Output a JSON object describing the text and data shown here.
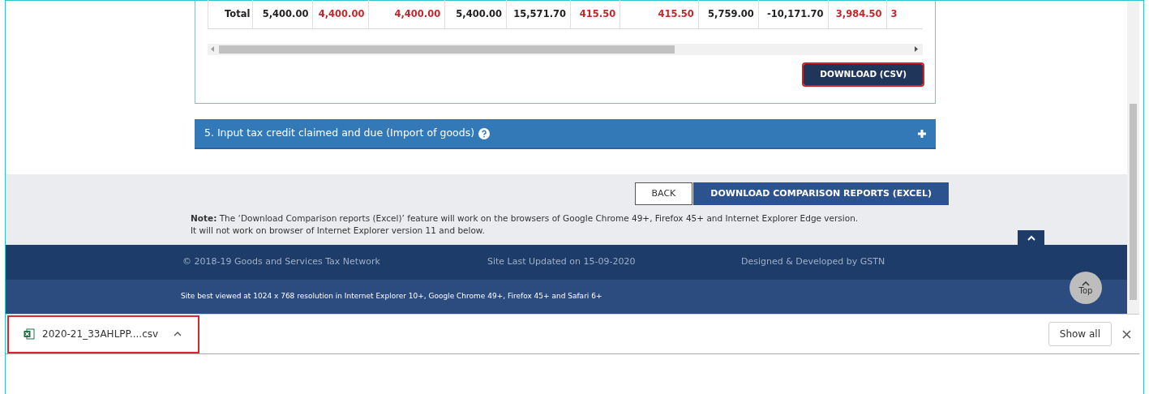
{
  "table": {
    "total_row": {
      "label": "Total",
      "cells": [
        {
          "text": "5,400.00",
          "highlight": false
        },
        {
          "text": "4,400.00",
          "highlight": true
        },
        {
          "text": "4,400.00",
          "highlight": true
        },
        {
          "text": "5,400.00",
          "highlight": false
        },
        {
          "text": "15,571.70",
          "highlight": false
        },
        {
          "text": "415.50",
          "highlight": true
        },
        {
          "text": "415.50",
          "highlight": true
        },
        {
          "text": "5,759.00",
          "highlight": false
        },
        {
          "text": "-10,171.70",
          "highlight": false
        },
        {
          "text": "3,984.50",
          "highlight": true
        },
        {
          "text": "3",
          "highlight": true
        }
      ]
    }
  },
  "download_csv_button": {
    "label": "DOWNLOAD (CSV)",
    "highlighted": true
  },
  "accordion": {
    "title": "5. Input tax credit claimed and due (Import of goods)",
    "expanded": false
  },
  "actions": [
    {
      "label": "BACK",
      "kind": "secondary"
    },
    {
      "label": "DOWNLOAD COMPARISON REPORTS (EXCEL)",
      "kind": "primary"
    }
  ],
  "note": "**Note:** The ‘Download Comparison reports (Excel)’ feature will work on the browsers of Google Chrome 49+, Firefox 45+ and Internet Explorer Edge version.\nIt will not work on browser of Internet Explorer version 11 and below.",
  "footer": {
    "copyright": "© 2018-19 Goods and Services Tax Network",
    "updated": "Site Last Updated on 15-09-2020",
    "designed": "Designed & Developed by GSTN",
    "best_viewed": "Site best viewed at 1024 x 768 resolution in Internet Explorer 10+, Google Chrome 49+, Firefox 45+ and Safari 6+",
    "top_button": "Top"
  },
  "download_bar": {
    "file": "2020-21_33AHLPP....csv",
    "highlighted": true,
    "show_all": "Show all"
  }
}
